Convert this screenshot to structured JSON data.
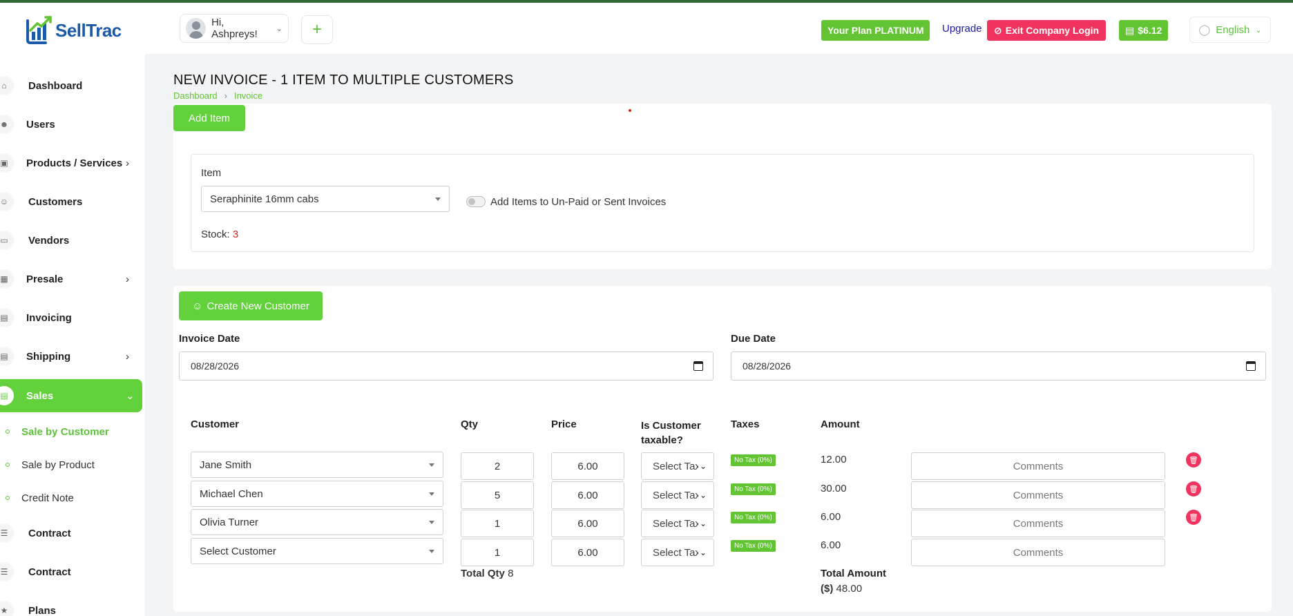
{
  "app": {
    "name": "SellTrac"
  },
  "header": {
    "greeting": "Hi, Ashpreys!",
    "plan": "Your Plan PLATINUM",
    "upgrade": "Upgrade",
    "exit": "Exit Company Login",
    "balance": "$6.12",
    "language": "English"
  },
  "sidebar": {
    "items": [
      {
        "label": "Dashboard"
      },
      {
        "label": "Users"
      },
      {
        "label": "Products / Services"
      },
      {
        "label": "Customers"
      },
      {
        "label": "Vendors"
      },
      {
        "label": "Presale"
      },
      {
        "label": "Invoicing"
      },
      {
        "label": "Shipping"
      },
      {
        "label": "Sales"
      },
      {
        "label": "Contract"
      },
      {
        "label": "Contract"
      },
      {
        "label": "Plans"
      }
    ],
    "sub_items": [
      {
        "label": "Sale by Customer"
      },
      {
        "label": "Sale by Product"
      },
      {
        "label": "Credit Note"
      }
    ]
  },
  "page": {
    "title": "NEW INVOICE - 1 ITEM TO MULTIPLE CUSTOMERS",
    "breadcrumb": [
      "Dashboard",
      "Invoice"
    ]
  },
  "item_section": {
    "add_item_label": "Add Item",
    "item_label": "Item",
    "item_value": "Seraphinite 16mm cabs",
    "toggle_label": "Add Items to Un-Paid or Sent Invoices",
    "stock_label": "Stock:",
    "stock_value": "3"
  },
  "customer_section": {
    "create_label": "Create New Customer",
    "invoice_date_label": "Invoice Date",
    "invoice_date": "08/28/2026",
    "due_date_label": "Due Date",
    "due_date": "08/28/2026",
    "columns": {
      "customer": "Customer",
      "qty": "Qty",
      "price": "Price",
      "taxable": "Is Customer taxable?",
      "taxes": "Taxes",
      "amount": "Amount"
    },
    "rows": [
      {
        "customer": "Jane Smith",
        "qty": "2",
        "price": "6.00",
        "taxable": "Select Tax",
        "tax": "No Tax (0%)",
        "amount": "12.00",
        "comment": "Comments"
      },
      {
        "customer": "Michael Chen",
        "qty": "5",
        "price": "6.00",
        "taxable": "Select Tax",
        "tax": "No Tax (0%)",
        "amount": "30.00",
        "comment": "Comments"
      },
      {
        "customer": "Olivia Turner",
        "qty": "1",
        "price": "6.00",
        "taxable": "Select Tax",
        "tax": "No Tax (0%)",
        "amount": "6.00",
        "comment": "Comments"
      },
      {
        "customer": "Select Customer",
        "qty": "1",
        "price": "6.00",
        "taxable": "Select Tax",
        "tax": "No Tax (0%)",
        "amount": "6.00",
        "comment": "Comments"
      }
    ],
    "total_qty_label": "Total Qty",
    "total_qty": "8",
    "total_amount_label": "Total Amount",
    "total_currency": "($)",
    "total_amount": "48.00"
  },
  "colors": {
    "accent": "#62d13c",
    "danger": "#f0345f",
    "brand": "#1b5aa8"
  }
}
